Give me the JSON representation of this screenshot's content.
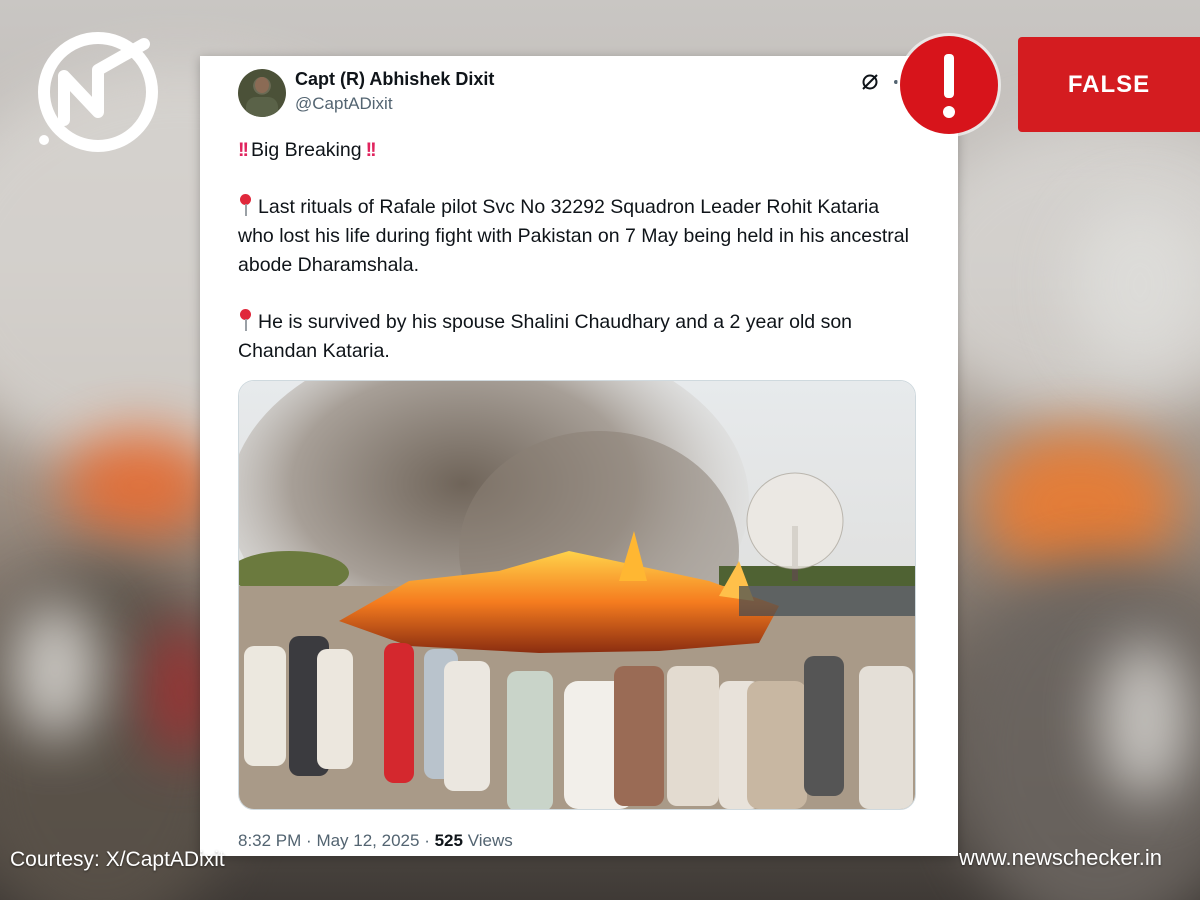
{
  "tweet": {
    "author_name": "Capt (R) Abhishek Dixit",
    "author_handle": "@CaptADixit",
    "headline": "Big Breaking",
    "paragraph_1": "Last rituals of Rafale pilot Svc No 32292 Squadron Leader Rohit Kataria who lost his life during fight with Pakistan on 7 May being held in his ancestral abode Dharamshala.",
    "paragraph_2": "He is survived by his spouse Shalini Chaudhary and a 2 year old son Chandan Kataria.",
    "time": "8:32 PM",
    "date": "May 12, 2025",
    "views_count": "525",
    "views_label": "Views"
  },
  "overlay": {
    "verdict": "FALSE",
    "courtesy": "Courtesy: X/CaptADixit",
    "website": "www.newschecker.in"
  },
  "icons": {
    "brand": "newschecker-logo",
    "alert": "exclamation-icon",
    "grok": "grok-icon",
    "location": "round-pushpin-icon",
    "emphasis": "double-exclamation-icon"
  },
  "colors": {
    "verdict_red": "#d41c20",
    "alert_red": "#d7141b",
    "text_primary": "#0f1419",
    "text_secondary": "#536471"
  }
}
